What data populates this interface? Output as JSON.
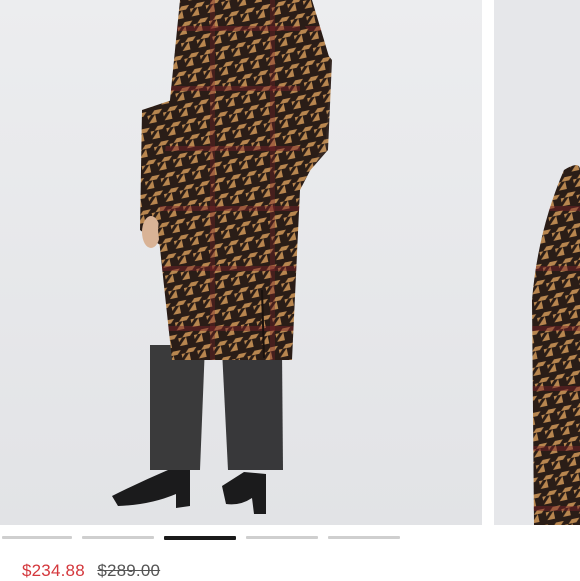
{
  "listing": {
    "sale_price": "$234.88",
    "original_price": "$289.00",
    "images": [
      {
        "icon": "houndstooth-coat-back-photo"
      },
      {
        "icon": "houndstooth-coat-side-photo"
      }
    ]
  },
  "carousel": {
    "slide_count": 5,
    "active_index": 2
  },
  "colors": {
    "sale_price": "#d4373c",
    "original_price": "#555555",
    "indicator_active": "#1a1a1a",
    "indicator_inactive": "#cfcfcf",
    "coat_tan": "#b8864f",
    "coat_dark": "#2a1d17",
    "coat_red": "#7a2228"
  }
}
